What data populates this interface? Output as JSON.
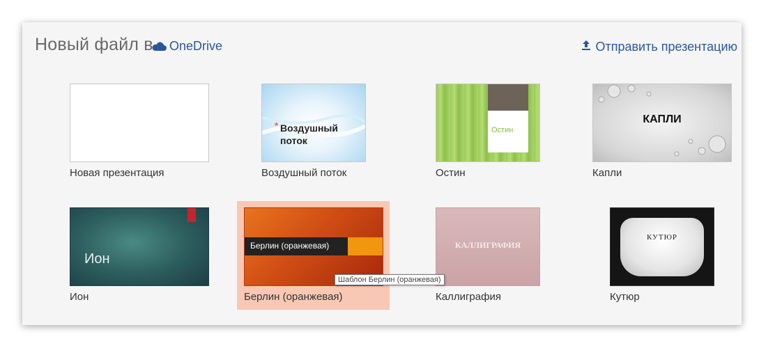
{
  "header": {
    "title": "Новый файл в",
    "location": "OneDrive",
    "upload_label": "Отправить презентацию"
  },
  "templates": [
    {
      "label": "Новая презентация",
      "thumb_text": ""
    },
    {
      "label": "Воздушный поток",
      "thumb_text": "Воздушный поток"
    },
    {
      "label": "Остин",
      "thumb_text": "Остин"
    },
    {
      "label": "Капли",
      "thumb_text": "КАПЛИ"
    },
    {
      "label": "Ион",
      "thumb_text": "Ион"
    },
    {
      "label": "Берлин (оранжевая)",
      "thumb_text": "Берлин (оранжевая)"
    },
    {
      "label": "Каллиграфия",
      "thumb_text": "КАЛЛИГРАФИЯ"
    },
    {
      "label": "Кутюр",
      "thumb_text": "КУТЮР"
    }
  ],
  "tooltip": "Шаблон Берлин (оранжевая)",
  "colors": {
    "accent": "#2b579a",
    "selected": "#f8c8b4"
  }
}
